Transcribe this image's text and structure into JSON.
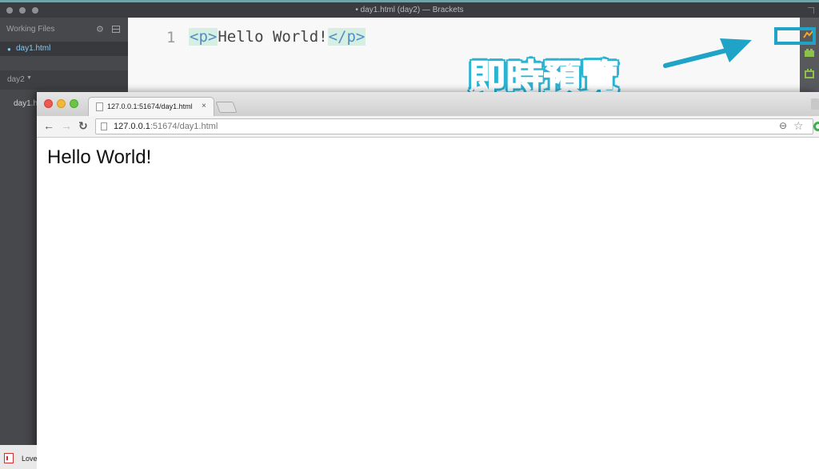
{
  "brackets": {
    "window_title": "• day1.html (day2) — Brackets",
    "sidebar": {
      "working_files_label": "Working Files",
      "working_file": "day1.html",
      "project_name": "day2",
      "tree_file": "day1.h"
    },
    "editor": {
      "line_number": "1",
      "code": {
        "open_tag": "<p>",
        "text": "Hello World!",
        "close_tag": "</p>"
      }
    },
    "toolbar_icons": [
      "live-preview-icon",
      "extension-manager-icon",
      "extension-icon"
    ]
  },
  "annotation": {
    "callout_text": "即時預覽",
    "colors": {
      "highlight": "#1fa3c6",
      "callout_fill": "#123a52"
    }
  },
  "chrome": {
    "tab_title": "127.0.0.1:51674/day1.html",
    "tab_close": "×",
    "url_host": "127.0.0.1",
    "url_rest": ":51674/day1.html",
    "page_text": "Hello World!"
  },
  "dock": {
    "label": "Love"
  }
}
